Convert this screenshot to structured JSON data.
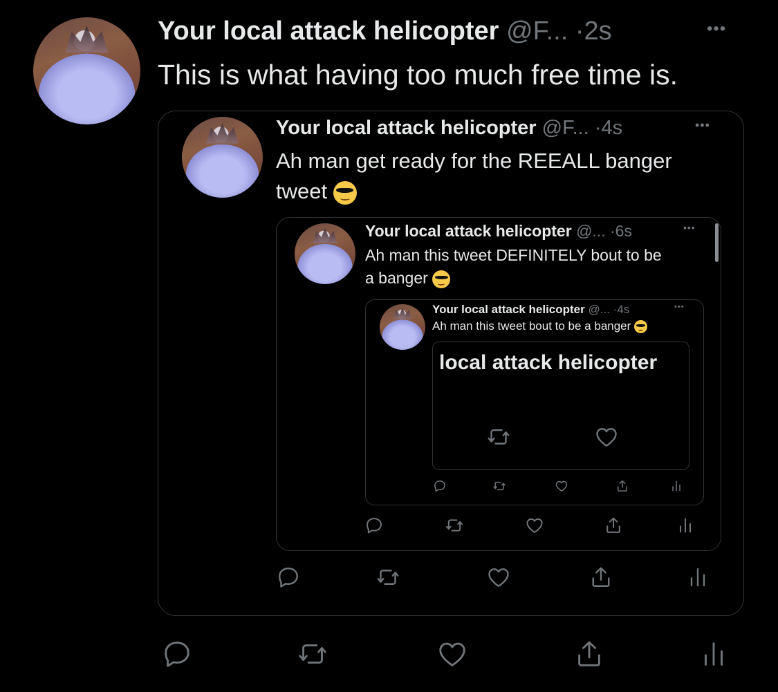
{
  "tweet": {
    "name": "Your local attack helicopter",
    "handle": "@F...",
    "separator": "·",
    "time": "2s",
    "more": "•••",
    "text": "This is what having too much free time is.",
    "quote": {
      "name": "Your local attack helicopter",
      "handle": "@F...",
      "separator": "·",
      "time": "4s",
      "more": "•••",
      "text_line1": "Ah man get ready for the REEALL banger",
      "text_line2": "tweet",
      "emoji": "smiling-face-with-sunglasses",
      "quote": {
        "name": "Your local attack helicopter",
        "handle": "@...",
        "separator": "·",
        "time": "6s",
        "more": "•••",
        "text_line1": "Ah man this tweet DEFINITELY bout to be",
        "text_line2": "a banger",
        "emoji": "smiling-face-with-sunglasses",
        "quote": {
          "name": "Your local attack helicopter",
          "handle": "@...",
          "separator": "·",
          "time": "4s",
          "more": "•••",
          "text": "Ah man this tweet bout to be a banger",
          "emoji": "smiling-face-with-sunglasses",
          "embed_text": "local attack helicopter"
        }
      }
    }
  },
  "icons": {
    "reply": "reply-icon",
    "retweet": "retweet-icon",
    "like": "heart-icon",
    "share": "share-icon",
    "analytics": "analytics-icon"
  },
  "colors": {
    "background": "#000000",
    "text": "#e7e9ea",
    "secondary": "#71767b",
    "border": "#2f3336"
  }
}
